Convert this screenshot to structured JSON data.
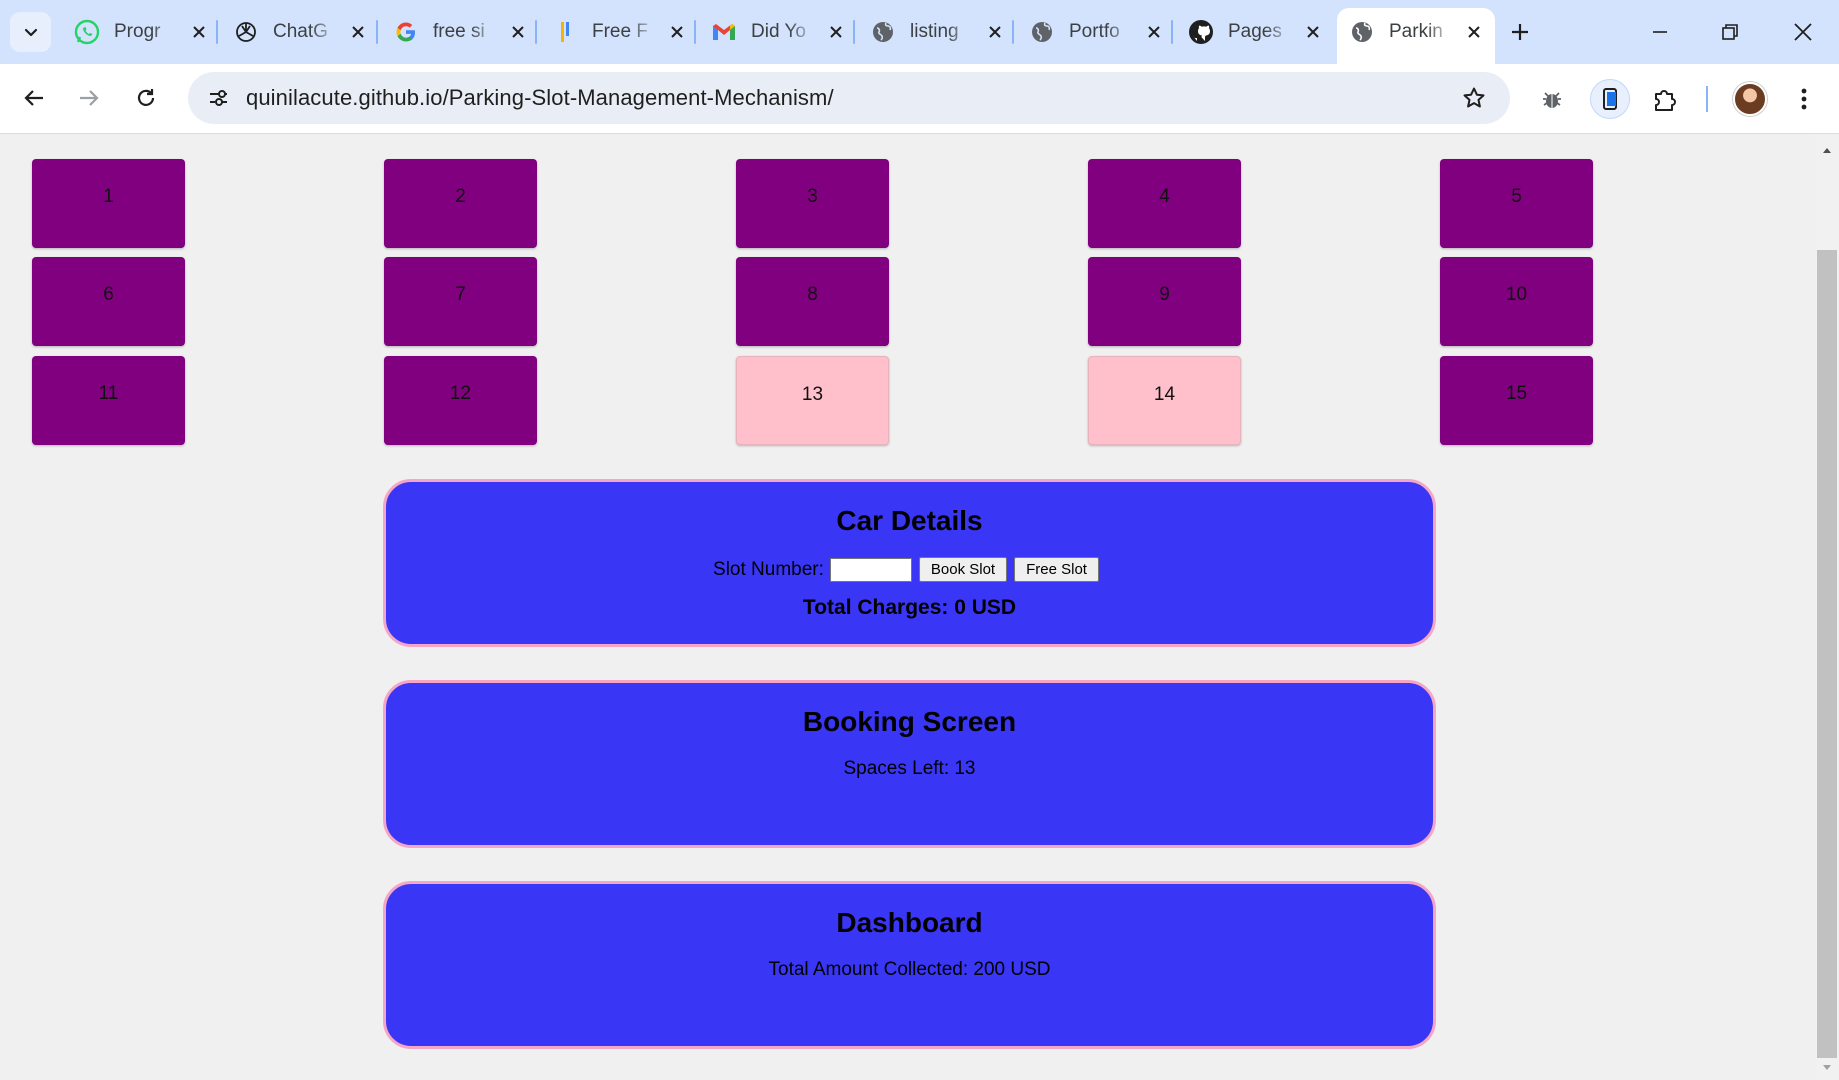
{
  "browser": {
    "tabs": [
      {
        "title": "Progr",
        "icon": "whatsapp-icon"
      },
      {
        "title": "ChatG",
        "icon": "chatgpt-icon"
      },
      {
        "title": "free si",
        "icon": "google-icon"
      },
      {
        "title": "Free F",
        "icon": "freepik-icon"
      },
      {
        "title": "Did Yo",
        "icon": "gmail-icon"
      },
      {
        "title": "listing",
        "icon": "globe-icon"
      },
      {
        "title": "Portfo",
        "icon": "globe-icon"
      },
      {
        "title": "Pages",
        "icon": "github-icon"
      },
      {
        "title": "Parkin",
        "icon": "globe-icon",
        "active": true
      }
    ],
    "url": "quinilacute.github.io/Parking-Slot-Management-Mechanism/"
  },
  "slots": [
    {
      "label": "1",
      "status": "occupied"
    },
    {
      "label": "2",
      "status": "occupied"
    },
    {
      "label": "3",
      "status": "occupied"
    },
    {
      "label": "4",
      "status": "occupied"
    },
    {
      "label": "5",
      "status": "occupied"
    },
    {
      "label": "6",
      "status": "occupied"
    },
    {
      "label": "7",
      "status": "occupied"
    },
    {
      "label": "8",
      "status": "occupied"
    },
    {
      "label": "9",
      "status": "occupied"
    },
    {
      "label": "10",
      "status": "occupied"
    },
    {
      "label": "11",
      "status": "occupied"
    },
    {
      "label": "12",
      "status": "occupied"
    },
    {
      "label": "13",
      "status": "free"
    },
    {
      "label": "14",
      "status": "free"
    },
    {
      "label": "15",
      "status": "occupied"
    }
  ],
  "car_details": {
    "title": "Car Details",
    "slot_label": "Slot Number:",
    "slot_value": "",
    "book_button": "Book Slot",
    "free_button": "Free Slot",
    "total_charges": "Total Charges: 0 USD"
  },
  "booking_screen": {
    "title": "Booking Screen",
    "spaces_left": "Spaces Left: 13"
  },
  "dashboard": {
    "title": "Dashboard",
    "total_collected": "Total Amount Collected: 200 USD"
  },
  "colors": {
    "occupied_slot": "#800080",
    "free_slot": "#ffc0cb",
    "panel_bg": "#3a36f5",
    "panel_border": "#f5a6c7"
  }
}
